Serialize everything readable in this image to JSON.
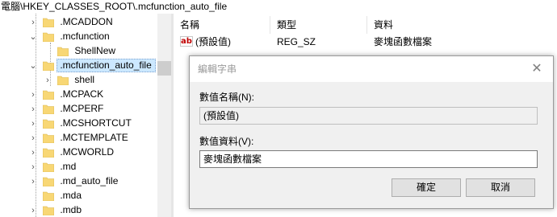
{
  "address_bar": {
    "path": "電腦\\HKEY_CLASSES_ROOT\\.mcfunction_auto_file"
  },
  "tree": {
    "items": [
      {
        "label": ".MCADDON",
        "chevron": "›"
      },
      {
        "label": ".mcfunction",
        "chevron": "⌄"
      },
      {
        "label": "ShellNew",
        "chevron": ""
      },
      {
        "label": ".mcfunction_auto_file",
        "chevron": "⌄",
        "selected": true
      },
      {
        "label": "shell",
        "chevron": "›"
      },
      {
        "label": ".MCPACK",
        "chevron": "›"
      },
      {
        "label": ".MCPERF",
        "chevron": "›"
      },
      {
        "label": ".MCSHORTCUT",
        "chevron": "›"
      },
      {
        "label": ".MCTEMPLATE",
        "chevron": "›"
      },
      {
        "label": ".MCWORLD",
        "chevron": "›"
      },
      {
        "label": ".md",
        "chevron": "›"
      },
      {
        "label": ".md_auto_file",
        "chevron": "›"
      },
      {
        "label": ".mda",
        "chevron": ""
      },
      {
        "label": ".mdb",
        "chevron": "›"
      }
    ]
  },
  "list": {
    "headers": {
      "name": "名稱",
      "type": "類型",
      "data": "資料"
    },
    "rows": [
      {
        "icon": "ab",
        "name": "(預設值)",
        "type": "REG_SZ",
        "data": "麥塊函數檔案"
      }
    ]
  },
  "dialog": {
    "title": "編輯字串",
    "close": "✕",
    "value_name_label": "數值名稱(N):",
    "value_name": "(預設值)",
    "value_data_label": "數值資料(V):",
    "value_data": "麥塊函數檔案",
    "ok_label": "確定",
    "cancel_label": "取消"
  },
  "colors": {
    "selection": "#cce8ff",
    "folder": "#f8d775",
    "dialog_bg": "#f0f0f0",
    "title_text": "#999999"
  }
}
